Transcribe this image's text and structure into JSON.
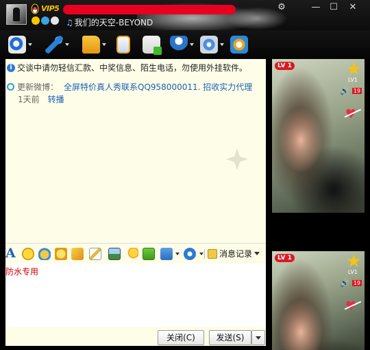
{
  "window": {
    "vip_label": "VIP5",
    "status_text": "我们的天空-BEYOND",
    "controls": {
      "settings": "⚙",
      "minimize": "—",
      "maximize": "☐",
      "close": "✕"
    }
  },
  "toolbar": {
    "items": [
      {
        "icon": "video-icon",
        "has_dropdown": true
      },
      {
        "icon": "mic-icon",
        "has_dropdown": true
      },
      {
        "icon": "folder-icon",
        "has_dropdown": true
      },
      {
        "icon": "phone-icon",
        "has_dropdown": false
      },
      {
        "icon": "app-add-icon",
        "has_dropdown": false
      },
      {
        "icon": "contacts-icon",
        "has_dropdown": true
      },
      {
        "icon": "remote-icon",
        "has_dropdown": true
      },
      {
        "icon": "share-icon",
        "has_dropdown": false
      }
    ]
  },
  "chat": {
    "notice": "交谈中请勿轻信汇款、中奖信息、陌生电话，勿使用外挂软件。",
    "weibo_label": "更新微博：",
    "weibo_text": "全屏特价真人秀联系QQ958000011. 招收实力代理",
    "weibo_time": "1天前",
    "weibo_forward": "转播"
  },
  "input_toolbar": {
    "font_label": "A",
    "message_record": "消息记录"
  },
  "input": {
    "text": "防水专用"
  },
  "buttons": {
    "close": "关闭(C)",
    "send": "发送(S)"
  },
  "show": {
    "level_badge": "LV 1",
    "small_level": "LV1",
    "count": "19"
  }
}
